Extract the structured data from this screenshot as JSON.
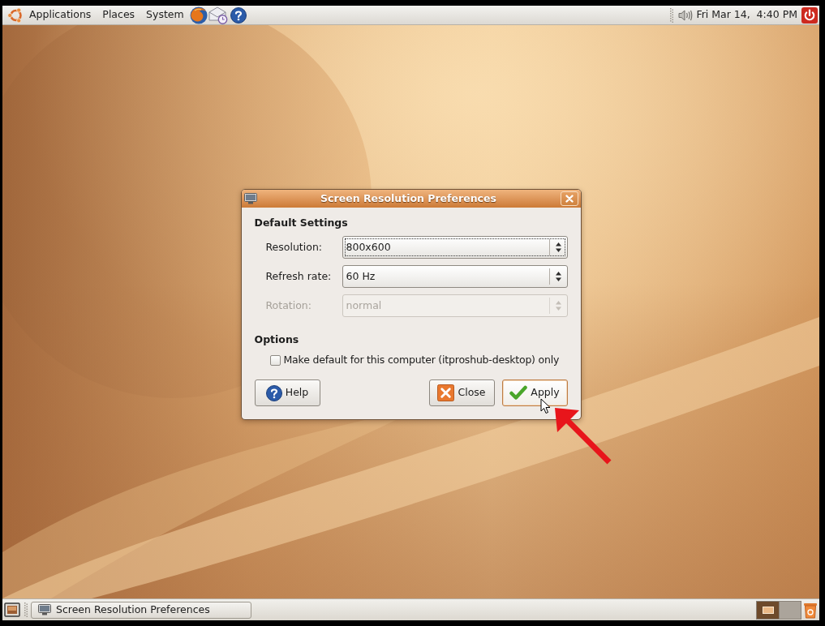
{
  "top_panel": {
    "menus": [
      {
        "label": "Applications"
      },
      {
        "label": "Places"
      },
      {
        "label": "System"
      }
    ],
    "clock": "Fri Mar 14,  4:40 PM"
  },
  "dialog": {
    "title": "Screen Resolution Preferences",
    "settings": {
      "heading": "Default Settings",
      "rows": [
        {
          "label": "Resolution:",
          "value": "800x600",
          "focused": true,
          "disabled": false
        },
        {
          "label": "Refresh rate:",
          "value": "60 Hz",
          "focused": false,
          "disabled": false
        },
        {
          "label": "Rotation:",
          "value": "normal",
          "focused": false,
          "disabled": true
        }
      ]
    },
    "options": {
      "heading": "Options",
      "checkbox": {
        "label": "Make default for this computer (itproshub-desktop) only",
        "checked": false
      }
    },
    "buttons": [
      {
        "kind": "help",
        "label": "Help",
        "hovered": false
      },
      {
        "kind": "close",
        "label": "Close",
        "hovered": false
      },
      {
        "kind": "apply",
        "label": "Apply",
        "hovered": true
      }
    ]
  },
  "bottom_panel": {
    "windows": [
      {
        "label": "Screen Resolution Preferences"
      }
    ],
    "workspaces": [
      {
        "selected": true
      },
      {
        "selected": false
      }
    ]
  }
}
